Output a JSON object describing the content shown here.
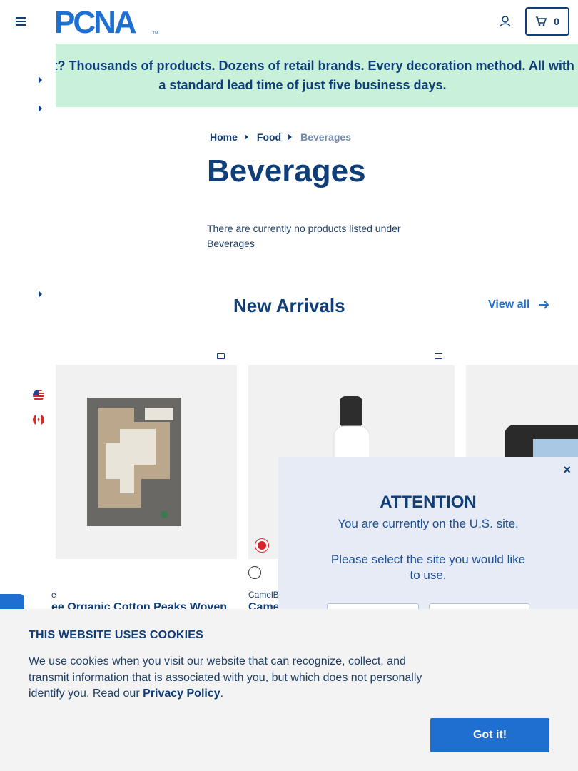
{
  "header": {
    "logo_text": "PCNA",
    "cart_count": "0"
  },
  "banner": {
    "text": "Wait? Thousands of products. Dozens of retail brands. Every decoration method. All with a standard lead time of just five business days."
  },
  "breadcrumb": {
    "items": [
      "Home",
      "Food"
    ],
    "current": "Beverages"
  },
  "page": {
    "title": "Beverages",
    "empty_message": "There are currently no products listed under Beverages"
  },
  "new_arrivals": {
    "title": "New Arrivals",
    "view_all": "View all",
    "products": [
      {
        "brand": "e",
        "name": "ee Organic Cotton Peaks Woven"
      },
      {
        "brand": "CamelB",
        "name": "Came"
      }
    ]
  },
  "modal": {
    "close": "×",
    "title": "ATTENTION",
    "line1": "You are currently on the U.S. site.",
    "line2": "Please select the site you would like to use."
  },
  "cookie": {
    "title": "THIS WEBSITE USES COOKIES",
    "text": "We use cookies when you visit our website that can recognize, collect, and transmit information that is associated with you, but which does not personally identify you. Read our",
    "link": "Privacy Policy",
    "period": ".",
    "button": "Got it!"
  },
  "colors": {
    "brand_navy": "#0f3e78",
    "accent_blue": "#1f6fd1",
    "banner_green": "#c9f0d8",
    "modal_bg": "#e6ebf6"
  }
}
